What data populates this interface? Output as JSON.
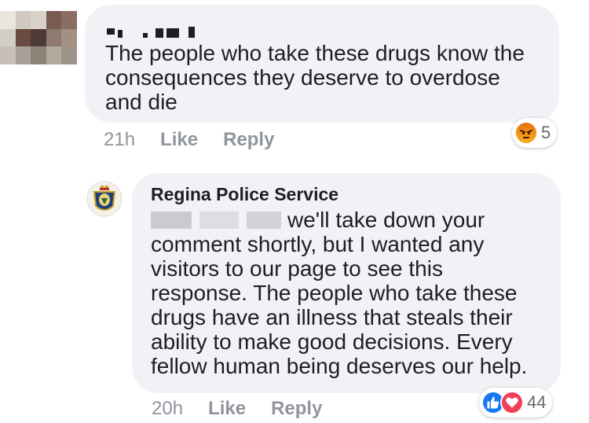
{
  "comment1": {
    "text": "The people who take these drugs know the\nconsequences they deserve to overdose\nand die",
    "time": "21h",
    "like_label": "Like",
    "reply_label": "Reply",
    "reactions": {
      "count": "5",
      "icons": [
        "angry-icon"
      ]
    }
  },
  "comment2": {
    "author": "Regina Police Service",
    "text_rest": "we'll take down your\ncomment shortly, but I wanted any\nvisitors to our page to see this\nresponse.  The people who take these\ndrugs have an illness that steals their\nability to make good decisions.  Every\nfellow human being deserves our help.",
    "time": "20h",
    "like_label": "Like",
    "reply_label": "Reply",
    "reactions": {
      "count": "44",
      "icons": [
        "like-icon",
        "love-icon"
      ]
    }
  },
  "colors": {
    "bubble": "#f0f2f5",
    "text": "#1c1e21",
    "meta": "#90949c",
    "like_blue": "#1877f2",
    "love_red": "#f33e58",
    "angry_orange": "#e9710f"
  }
}
